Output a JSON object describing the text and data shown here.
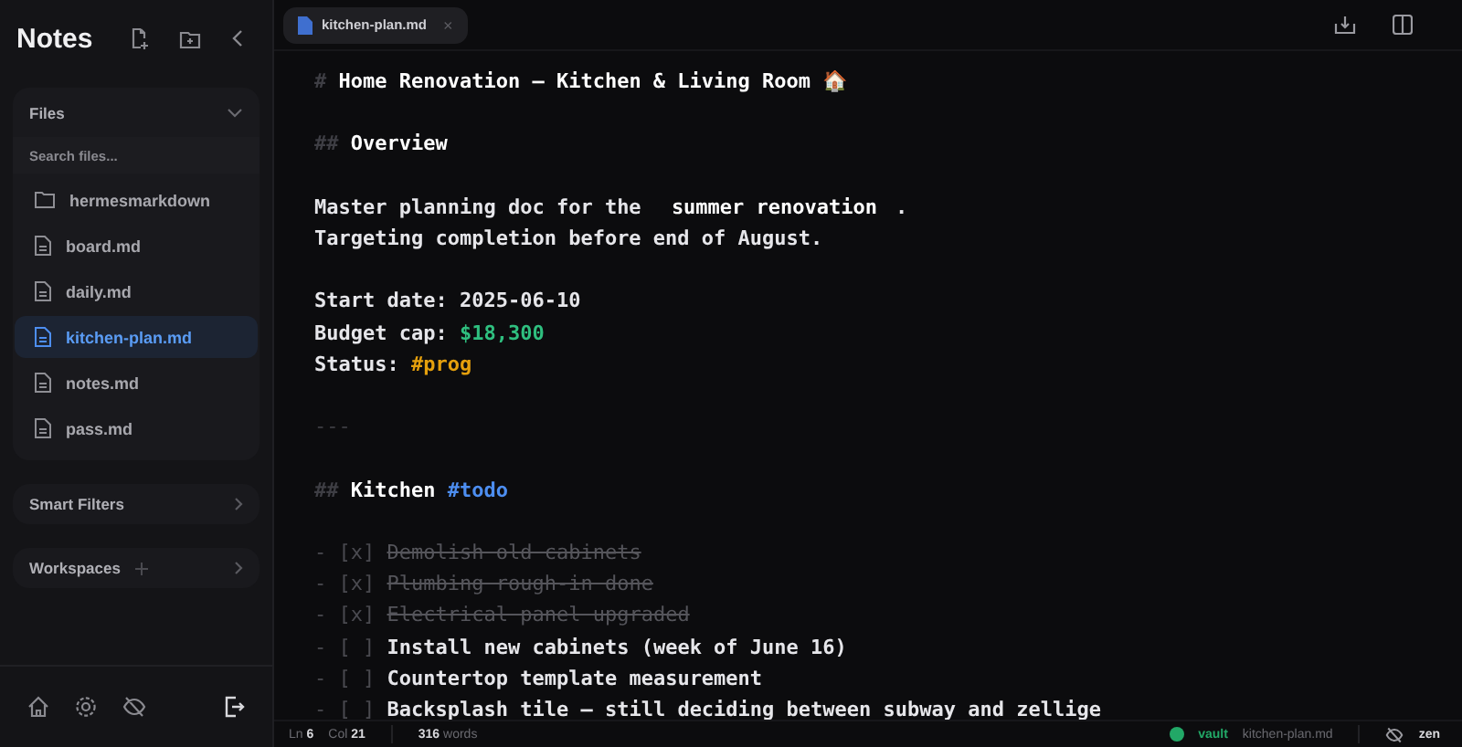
{
  "sidebar": {
    "title": "Notes",
    "files": {
      "label": "Files",
      "expanded": true,
      "search_placeholder": "Search files...",
      "items": [
        {
          "name": "hermesmarkdown",
          "kind": "folder",
          "selected": false
        },
        {
          "name": "board.md",
          "kind": "file",
          "selected": false
        },
        {
          "name": "daily.md",
          "kind": "file",
          "selected": false
        },
        {
          "name": "kitchen-plan.md",
          "kind": "file",
          "selected": true
        },
        {
          "name": "notes.md",
          "kind": "file",
          "selected": false
        },
        {
          "name": "pass.md",
          "kind": "file",
          "selected": false
        }
      ]
    },
    "sections": [
      {
        "label": "Smart Filters",
        "addable": false
      },
      {
        "label": "Workspaces",
        "addable": true
      }
    ]
  },
  "tabs": [
    {
      "label": "kitchen-plan.md",
      "selected": true,
      "close": "×"
    }
  ],
  "editor": {
    "blocks": [
      {
        "kind": "heading",
        "marker": "#",
        "text": "Home Renovation — Kitchen & Living Room 🏠"
      },
      {
        "kind": "heading",
        "marker": "##",
        "text": "Overview"
      },
      {
        "kind": "para",
        "lines": [
          [
            {
              "kind": "text",
              "text": "Master planning doc for the "
            },
            {
              "kind": "bold",
              "text": "summer renovation"
            },
            {
              "kind": "text",
              "text": "."
            }
          ],
          [
            {
              "kind": "text",
              "text": "Targeting completion before end of August."
            }
          ]
        ]
      },
      {
        "kind": "para",
        "lines": [
          [
            {
              "kind": "text",
              "text": "Start date: 2025-06-10"
            }
          ],
          [
            {
              "kind": "text",
              "text": "Budget cap: "
            },
            {
              "kind": "money",
              "text": "$18,300"
            }
          ],
          [
            {
              "kind": "text",
              "text": "Status: "
            },
            {
              "kind": "tag",
              "text": "#prog",
              "color": "#e5a00d"
            }
          ]
        ]
      },
      {
        "kind": "rule",
        "marker": "---"
      },
      {
        "kind": "heading",
        "marker": "##",
        "text": "Kitchen ",
        "tag": {
          "text": "#todo",
          "color": "#4d8ef0"
        }
      },
      {
        "kind": "tasks",
        "items": [
          {
            "checked": true,
            "marker": "- [x]",
            "text": "Demolish old cabinets"
          },
          {
            "checked": true,
            "marker": "- [x]",
            "text": "Plumbing rough-in done"
          },
          {
            "checked": true,
            "marker": "- [x]",
            "text": "Electrical panel upgraded"
          },
          {
            "checked": false,
            "marker": "- [ ]",
            "text": "Install new cabinets (week of June 16)"
          },
          {
            "checked": false,
            "marker": "- [ ]",
            "text": "Countertop template measurement"
          },
          {
            "checked": false,
            "marker": "- [ ]",
            "text": "Backsplash tile — still deciding between subway and zellige"
          }
        ]
      }
    ]
  },
  "status_bar": {
    "line_label": "Ln",
    "line": "6",
    "col_label": "Col",
    "col": "21",
    "words": "316",
    "words_label": "words",
    "vault": "vault",
    "file": "kitchen-plan.md",
    "zen": "zen"
  }
}
